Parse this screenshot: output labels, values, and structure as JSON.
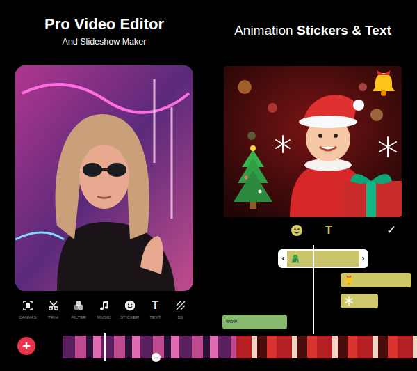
{
  "left_panel": {
    "title": "Pro Video Editor",
    "subtitle": "And Slideshow Maker",
    "toolbar": [
      {
        "label": "CANVAS"
      },
      {
        "label": "TRIM"
      },
      {
        "label": "FILTER"
      },
      {
        "label": "MUSIC"
      },
      {
        "label": "STICKER"
      },
      {
        "label": "TEXT",
        "glyph": "T"
      },
      {
        "label": "BG"
      }
    ]
  },
  "right_panel": {
    "title_regular": "Animation",
    "title_bold": "Stickers & Text",
    "editor_tools": {
      "text_tool": "T",
      "done": "✓"
    },
    "handles": [
      "‹",
      "›"
    ],
    "tracks": [
      {
        "kind": "sticker",
        "selected": true,
        "color": "#c9c46b"
      },
      {
        "kind": "sticker",
        "selected": false,
        "color": "#cfc766"
      },
      {
        "kind": "sticker",
        "selected": false,
        "color": "#cdc76d"
      },
      {
        "kind": "text",
        "label": "wow",
        "selected": false,
        "color": "#86b86e"
      }
    ]
  },
  "bottom_bar": {
    "add_button": "+",
    "scroll_arrow": "→"
  }
}
